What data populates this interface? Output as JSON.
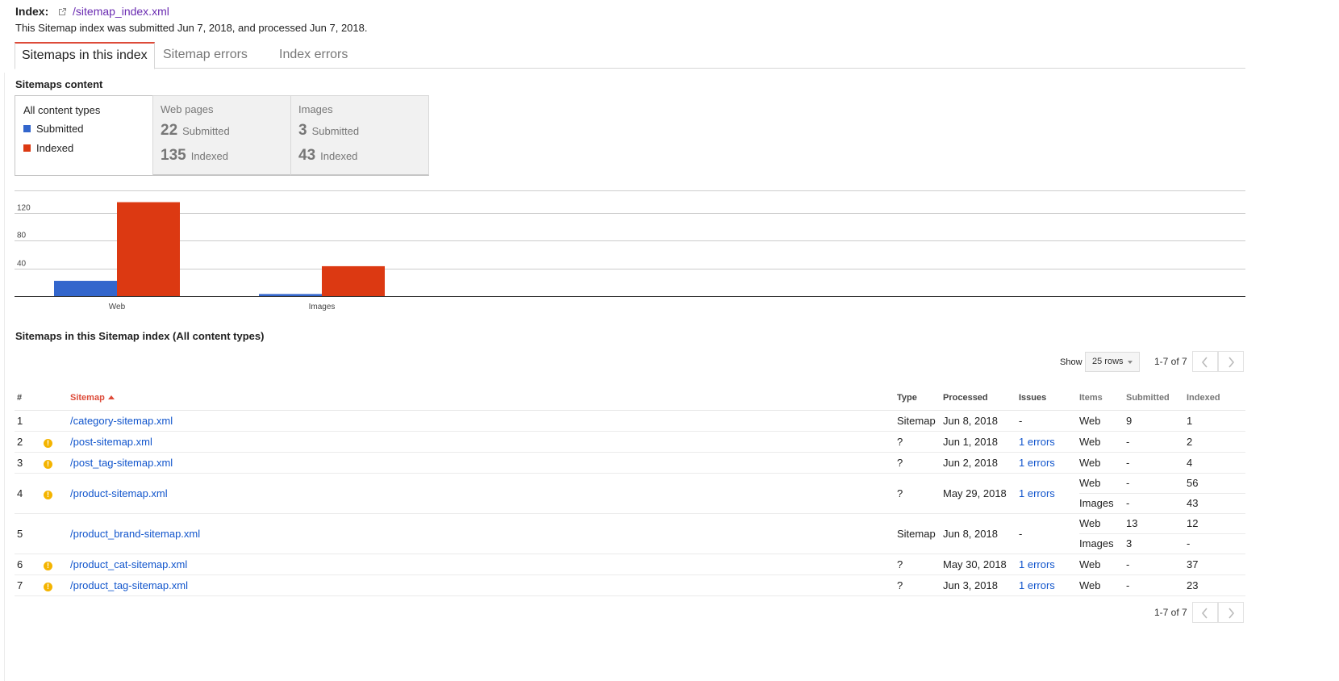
{
  "header": {
    "label": "Index:",
    "link": "/sitemap_index.xml",
    "subtitle": "This Sitemap index was submitted Jun 7, 2018, and processed Jun 7, 2018."
  },
  "tabs": [
    "Sitemaps in this index",
    "Sitemap errors",
    "Index errors"
  ],
  "content_section_title": "Sitemaps content",
  "content_types": {
    "all": {
      "title": "All content types",
      "legend": [
        {
          "label": "Submitted",
          "color": "#3366cc"
        },
        {
          "label": "Indexed",
          "color": "#dc3912"
        }
      ]
    },
    "web": {
      "title": "Web pages",
      "submitted": "22",
      "submitted_label": "Submitted",
      "indexed": "135",
      "indexed_label": "Indexed"
    },
    "images": {
      "title": "Images",
      "submitted": "3",
      "submitted_label": "Submitted",
      "indexed": "43",
      "indexed_label": "Indexed"
    }
  },
  "chart_data": {
    "type": "bar",
    "categories": [
      "Web",
      "Images"
    ],
    "series": [
      {
        "name": "Submitted",
        "color": "#3366cc",
        "values": [
          22,
          3
        ]
      },
      {
        "name": "Indexed",
        "color": "#dc3912",
        "values": [
          135,
          43
        ]
      }
    ],
    "yticks": [
      40,
      80,
      120,
      160
    ],
    "ylim": [
      0,
      160
    ]
  },
  "table_section_title": "Sitemaps in this Sitemap index (All content types)",
  "controls": {
    "show_label": "Show",
    "rows_value": "25 rows",
    "pager": "1-7 of 7"
  },
  "table": {
    "headers": {
      "num": "#",
      "sitemap": "Sitemap",
      "type": "Type",
      "processed": "Processed",
      "issues": "Issues",
      "items": "Items",
      "submitted": "Submitted",
      "indexed": "Indexed"
    },
    "rows": [
      {
        "num": "1",
        "warn": false,
        "sitemap": "/category-sitemap.xml",
        "type": "Sitemap",
        "processed": "Jun 8, 2018",
        "issues": "-",
        "items": [
          {
            "item": "Web",
            "submitted": "9",
            "indexed": "1"
          }
        ]
      },
      {
        "num": "2",
        "warn": true,
        "sitemap": "/post-sitemap.xml",
        "type": "?",
        "processed": "Jun 1, 2018",
        "issues": "1 errors",
        "items": [
          {
            "item": "Web",
            "submitted": "-",
            "indexed": "2"
          }
        ]
      },
      {
        "num": "3",
        "warn": true,
        "sitemap": "/post_tag-sitemap.xml",
        "type": "?",
        "processed": "Jun 2, 2018",
        "issues": "1 errors",
        "items": [
          {
            "item": "Web",
            "submitted": "-",
            "indexed": "4"
          }
        ]
      },
      {
        "num": "4",
        "warn": true,
        "sitemap": "/product-sitemap.xml",
        "type": "?",
        "processed": "May 29, 2018",
        "issues": "1 errors",
        "items": [
          {
            "item": "Web",
            "submitted": "-",
            "indexed": "56"
          },
          {
            "item": "Images",
            "submitted": "-",
            "indexed": "43"
          }
        ]
      },
      {
        "num": "5",
        "warn": false,
        "sitemap": "/product_brand-sitemap.xml",
        "type": "Sitemap",
        "processed": "Jun 8, 2018",
        "issues": "-",
        "items": [
          {
            "item": "Web",
            "submitted": "13",
            "indexed": "12"
          },
          {
            "item": "Images",
            "submitted": "3",
            "indexed": "-"
          }
        ]
      },
      {
        "num": "6",
        "warn": true,
        "sitemap": "/product_cat-sitemap.xml",
        "type": "?",
        "processed": "May 30, 2018",
        "issues": "1 errors",
        "items": [
          {
            "item": "Web",
            "submitted": "-",
            "indexed": "37"
          }
        ]
      },
      {
        "num": "7",
        "warn": true,
        "sitemap": "/product_tag-sitemap.xml",
        "type": "?",
        "processed": "Jun 3, 2018",
        "issues": "1 errors",
        "items": [
          {
            "item": "Web",
            "submitted": "-",
            "indexed": "23"
          }
        ]
      }
    ]
  }
}
